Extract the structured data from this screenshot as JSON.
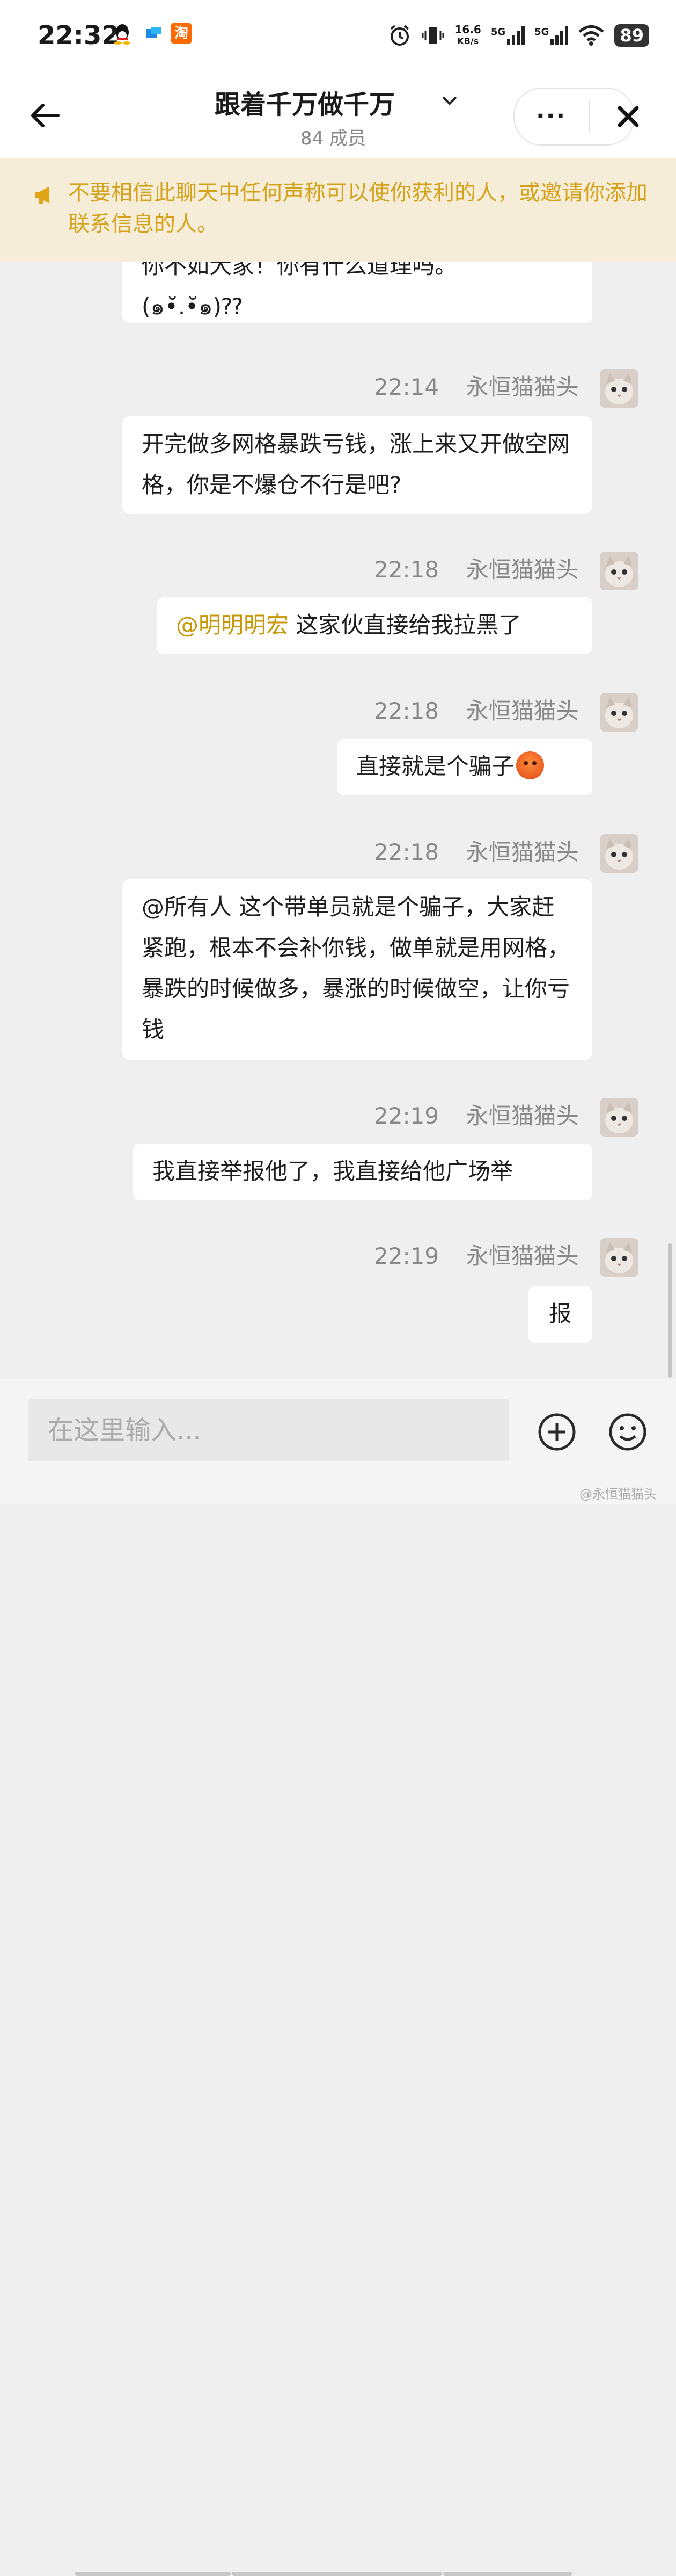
{
  "status_bar": {
    "time": "22:32",
    "net_speed_value": "16.6",
    "net_speed_unit": "KB/s",
    "sim1": "5G",
    "sim2": "5G",
    "battery": "89",
    "app_icons": [
      "qq-icon",
      "cloud-app-icon",
      "taobao-icon"
    ],
    "taobao_char": "淘"
  },
  "header": {
    "title": "跟着千万做千万",
    "subtitle": "84 成员",
    "more_label": "···"
  },
  "banner": {
    "text": "不要相信此聊天中任何声称可以使你获利的人，或邀请你添加联系信息的人。",
    "color": "#d4a21a"
  },
  "messages": [
    {
      "partial": true,
      "line1": "你不如大家！你有什么道理吗。",
      "line2": "(๑•̆.•̆๑)⁇"
    },
    {
      "time": "22:14",
      "sender": "永恒猫猫头",
      "text": "开完做多网格暴跌亏钱，涨上来又开做空网格，你是不爆仓不行是吧?"
    },
    {
      "time": "22:18",
      "sender": "永恒猫猫头",
      "mention": "@明明明宏",
      "text": " 这家伙直接给我拉黑了"
    },
    {
      "time": "22:18",
      "sender": "永恒猫猫头",
      "text": "直接就是个骗子"
    },
    {
      "time": "22:18",
      "sender": "永恒猫猫头",
      "text": "@所有人 这个带单员就是个骗子，大家赶紧跑，根本不会补你钱，做单就是用网格，暴跌的时候做多，暴涨的时候做空，让你亏钱"
    },
    {
      "time": "22:19",
      "sender": "永恒猫猫头",
      "text": "我直接举报他了，我直接给他广场举"
    },
    {
      "time": "22:19",
      "sender": "永恒猫猫头",
      "text": "报"
    }
  ],
  "input": {
    "placeholder": "在这里输入..."
  },
  "watermark": "@永恒猫猫头"
}
